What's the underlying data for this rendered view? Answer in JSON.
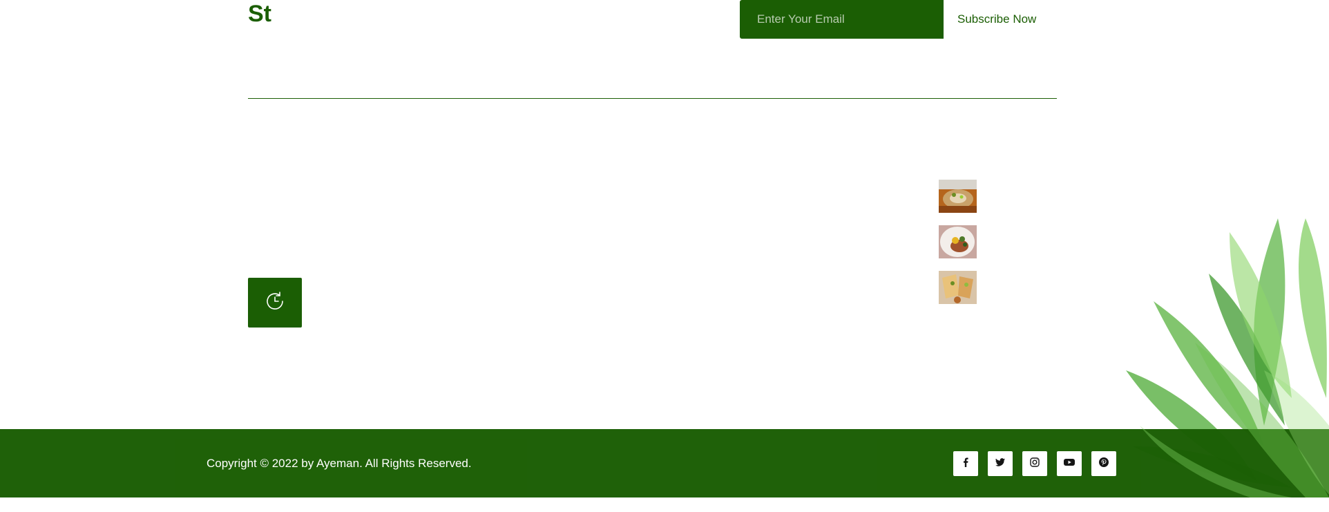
{
  "header": {
    "logo_text": "St",
    "subscribe": {
      "email_placeholder": "Enter Your Email",
      "button_label": "Subscribe Now"
    }
  },
  "gallery": {
    "thumbnails": [
      "food-photo-1",
      "food-photo-2",
      "food-photo-3"
    ]
  },
  "history_button": {
    "icon": "history-icon"
  },
  "footer": {
    "copyright": "Copyright © 2022 by Ayeman. All Rights Reserved.",
    "socials": [
      "facebook-icon",
      "twitter-icon",
      "instagram-icon",
      "youtube-icon",
      "pinterest-icon"
    ]
  },
  "colors": {
    "brand_green": "#1b5e04",
    "white": "#ffffff"
  }
}
